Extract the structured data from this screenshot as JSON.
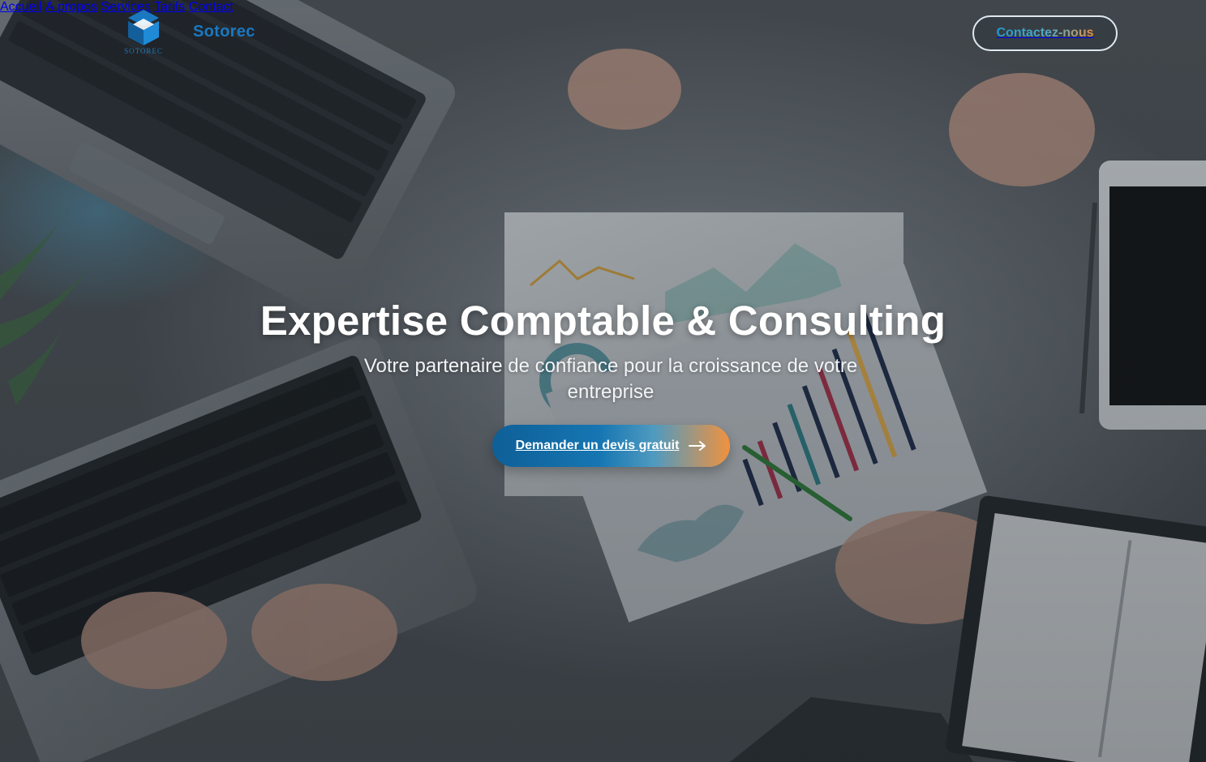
{
  "header": {
    "logo_caption": "SOTOREC",
    "brand_name": "Sotorec",
    "menu": [
      {
        "label": "Accueil"
      },
      {
        "label": "À propos"
      },
      {
        "label": "Services"
      },
      {
        "label": "Tarifs"
      },
      {
        "label": "Contact"
      }
    ],
    "cta_label": "Contactez-nous"
  },
  "hero": {
    "title": "Expertise Comptable & Consulting",
    "subtitle": "Votre partenaire de confiance pour la croissance de votre entreprise",
    "cta_label": "Demander un devis gratuit",
    "cta_icon": "arrow-right-icon",
    "background_image": "office-desk-photo"
  },
  "colors": {
    "brand_blue": "#1a78c0",
    "accent_orange": "#f0923f",
    "text_white": "#ffffff"
  }
}
